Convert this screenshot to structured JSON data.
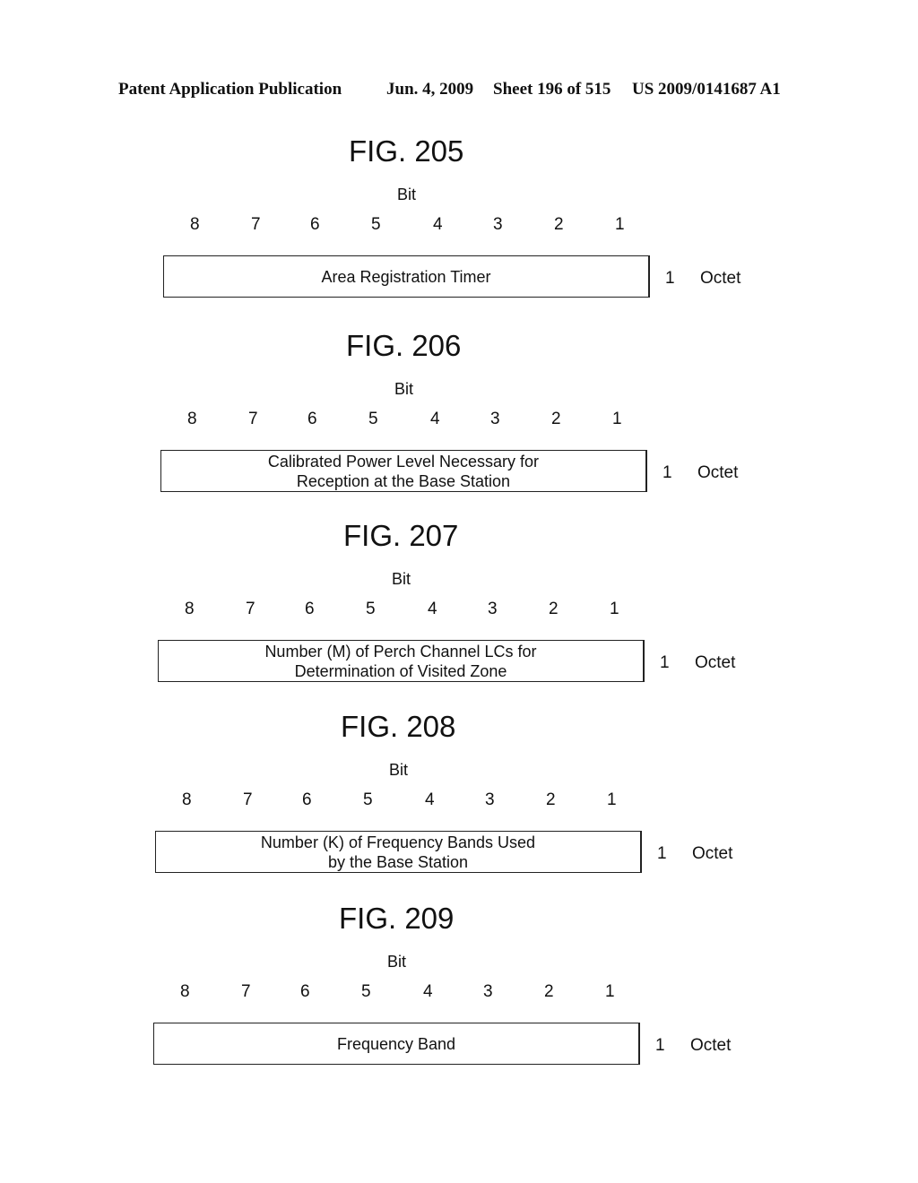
{
  "header": {
    "publication": "Patent Application Publication",
    "date": "Jun. 4, 2009",
    "sheet": "Sheet 196 of 515",
    "number": "US 2009/0141687 A1"
  },
  "figures": [
    {
      "title": "FIG. 205",
      "bit_label": "Bit",
      "bits": [
        "8",
        "7",
        "6",
        "5",
        "4",
        "3",
        "2",
        "1"
      ],
      "field_line1": "Area Registration Timer",
      "field_line2": "",
      "octet_number": "1",
      "octet_label": "Octet"
    },
    {
      "title": "FIG. 206",
      "bit_label": "Bit",
      "bits": [
        "8",
        "7",
        "6",
        "5",
        "4",
        "3",
        "2",
        "1"
      ],
      "field_line1": "Calibrated Power Level Necessary for",
      "field_line2": "Reception at the Base Station",
      "octet_number": "1",
      "octet_label": "Octet"
    },
    {
      "title": "FIG. 207",
      "bit_label": "Bit",
      "bits": [
        "8",
        "7",
        "6",
        "5",
        "4",
        "3",
        "2",
        "1"
      ],
      "field_line1": "Number (M) of Perch Channel LCs for",
      "field_line2": "Determination of Visited Zone",
      "octet_number": "1",
      "octet_label": "Octet"
    },
    {
      "title": "FIG. 208",
      "bit_label": "Bit",
      "bits": [
        "8",
        "7",
        "6",
        "5",
        "4",
        "3",
        "2",
        "1"
      ],
      "field_line1": "Number (K) of Frequency Bands Used",
      "field_line2": "by the Base Station",
      "octet_number": "1",
      "octet_label": "Octet"
    },
    {
      "title": "FIG. 209",
      "bit_label": "Bit",
      "bits": [
        "8",
        "7",
        "6",
        "5",
        "4",
        "3",
        "2",
        "1"
      ],
      "field_line1": "Frequency Band",
      "field_line2": "",
      "octet_number": "1",
      "octet_label": "Octet"
    }
  ]
}
